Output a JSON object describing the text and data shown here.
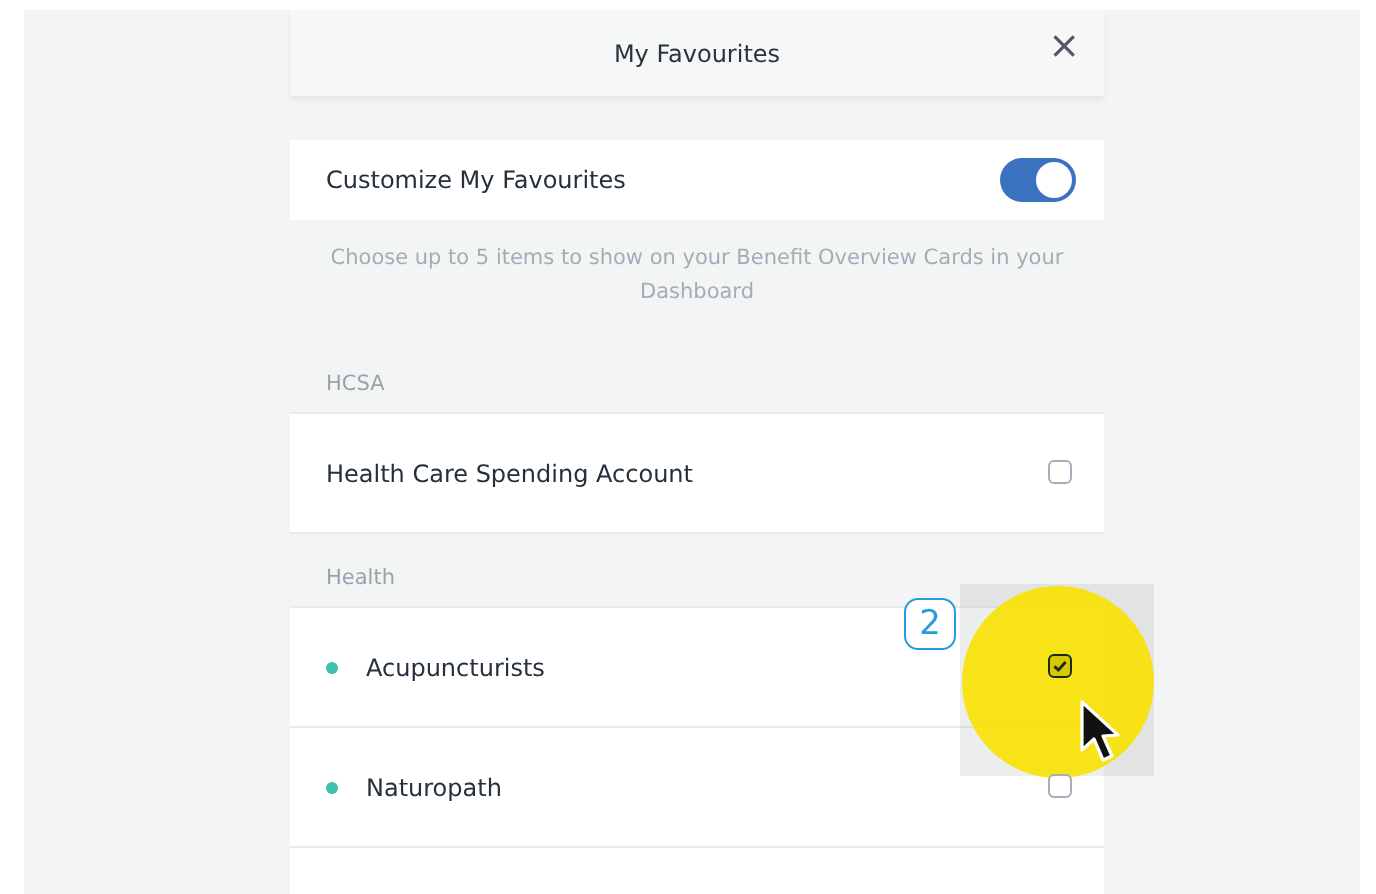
{
  "dialog": {
    "title": "My Favourites",
    "close_label": "×"
  },
  "customize": {
    "label": "Customize My Favourites",
    "on": true
  },
  "description": "Choose up to 5 items to show on your Benefit Overview Cards in your Dashboard",
  "sections": [
    {
      "label": "HCSA",
      "items": [
        {
          "label": "Health Care Spending Account",
          "bullet": false,
          "checked": false
        }
      ]
    },
    {
      "label": "Health",
      "items": [
        {
          "label": "Acupuncturists",
          "bullet": true,
          "checked": true
        },
        {
          "label": "Naturopath",
          "bullet": true,
          "checked": false
        }
      ]
    }
  ],
  "annotation": {
    "step": "2"
  }
}
